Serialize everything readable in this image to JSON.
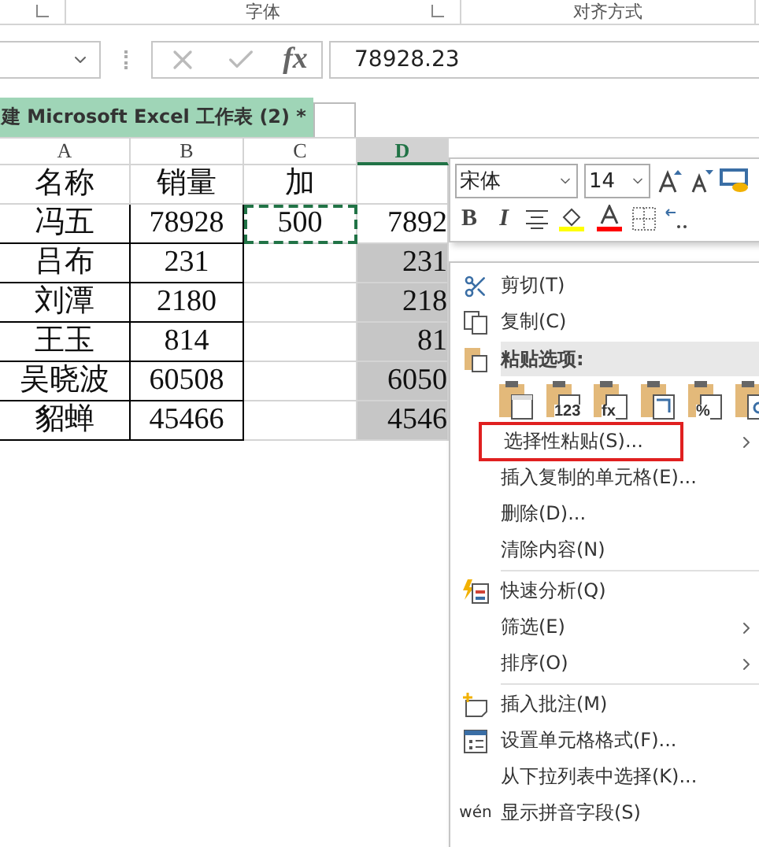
{
  "ribbon_groups": [
    {
      "label": "字体"
    },
    {
      "label": "对齐方式"
    }
  ],
  "formula_bar": {
    "fx": "fx",
    "value": "78928.23"
  },
  "workbook_tab": {
    "label": "建 Microsoft Excel 工作表 (2) *",
    "selected": true
  },
  "columns": [
    {
      "label": "A",
      "selected": false
    },
    {
      "label": "B",
      "selected": false
    },
    {
      "label": "C",
      "selected": false
    },
    {
      "label": "D",
      "selected": true
    }
  ],
  "header_row": [
    "名称",
    "销量",
    "加"
  ],
  "rows": [
    [
      "冯五",
      "78928",
      "500",
      "7892"
    ],
    [
      "吕布",
      "231",
      "",
      "231"
    ],
    [
      "刘潭",
      "2180",
      "",
      "218"
    ],
    [
      "王玉",
      "814",
      "",
      "81"
    ],
    [
      "吴晓波",
      "60508",
      "",
      "6050"
    ],
    [
      "貂蝉",
      "45466",
      "",
      "4546"
    ]
  ],
  "mini_toolbar": {
    "font": "宋体",
    "size": "14",
    "bold": "B",
    "italic": "I"
  },
  "menu": [
    {
      "kind": "cut",
      "label": "剪切(T)"
    },
    {
      "kind": "copy",
      "label": "复制(C)"
    },
    {
      "kind": "paste-header",
      "label": "粘贴选项:"
    },
    {
      "kind": "paste-options",
      "options": [
        {
          "kind": "paste"
        },
        {
          "kind": "values",
          "text": "123"
        },
        {
          "kind": "formulas",
          "text": "fx"
        },
        {
          "kind": "transpose"
        },
        {
          "kind": "formatting",
          "text": "%"
        },
        {
          "kind": "link"
        }
      ]
    },
    {
      "kind": "plain",
      "label": "选择性粘贴(S)...",
      "submenu": true,
      "highlighted": true
    },
    {
      "kind": "plain",
      "label": "插入复制的单元格(E)...",
      "submenu": false,
      "highlighted": false
    },
    {
      "kind": "plain",
      "label": "删除(D)...",
      "submenu": false,
      "highlighted": false
    },
    {
      "kind": "plain",
      "label": "清除内容(N)",
      "submenu": false,
      "highlighted": false
    },
    {
      "kind": "separator"
    },
    {
      "kind": "analysis",
      "label": "快速分析(Q)"
    },
    {
      "kind": "plain",
      "label": "筛选(E)",
      "submenu": true,
      "highlighted": false
    },
    {
      "kind": "plain",
      "label": "排序(O)",
      "submenu": true,
      "highlighted": false
    },
    {
      "kind": "separator"
    },
    {
      "kind": "comment",
      "label": "插入批注(M)"
    },
    {
      "kind": "format",
      "label": "设置单元格格式(F)..."
    },
    {
      "kind": "plain",
      "label": "从下拉列表中选择(K)...",
      "submenu": false,
      "highlighted": false
    },
    {
      "kind": "pinyin",
      "label": "显示拼音字段(S)",
      "icon_text": "wén"
    }
  ]
}
